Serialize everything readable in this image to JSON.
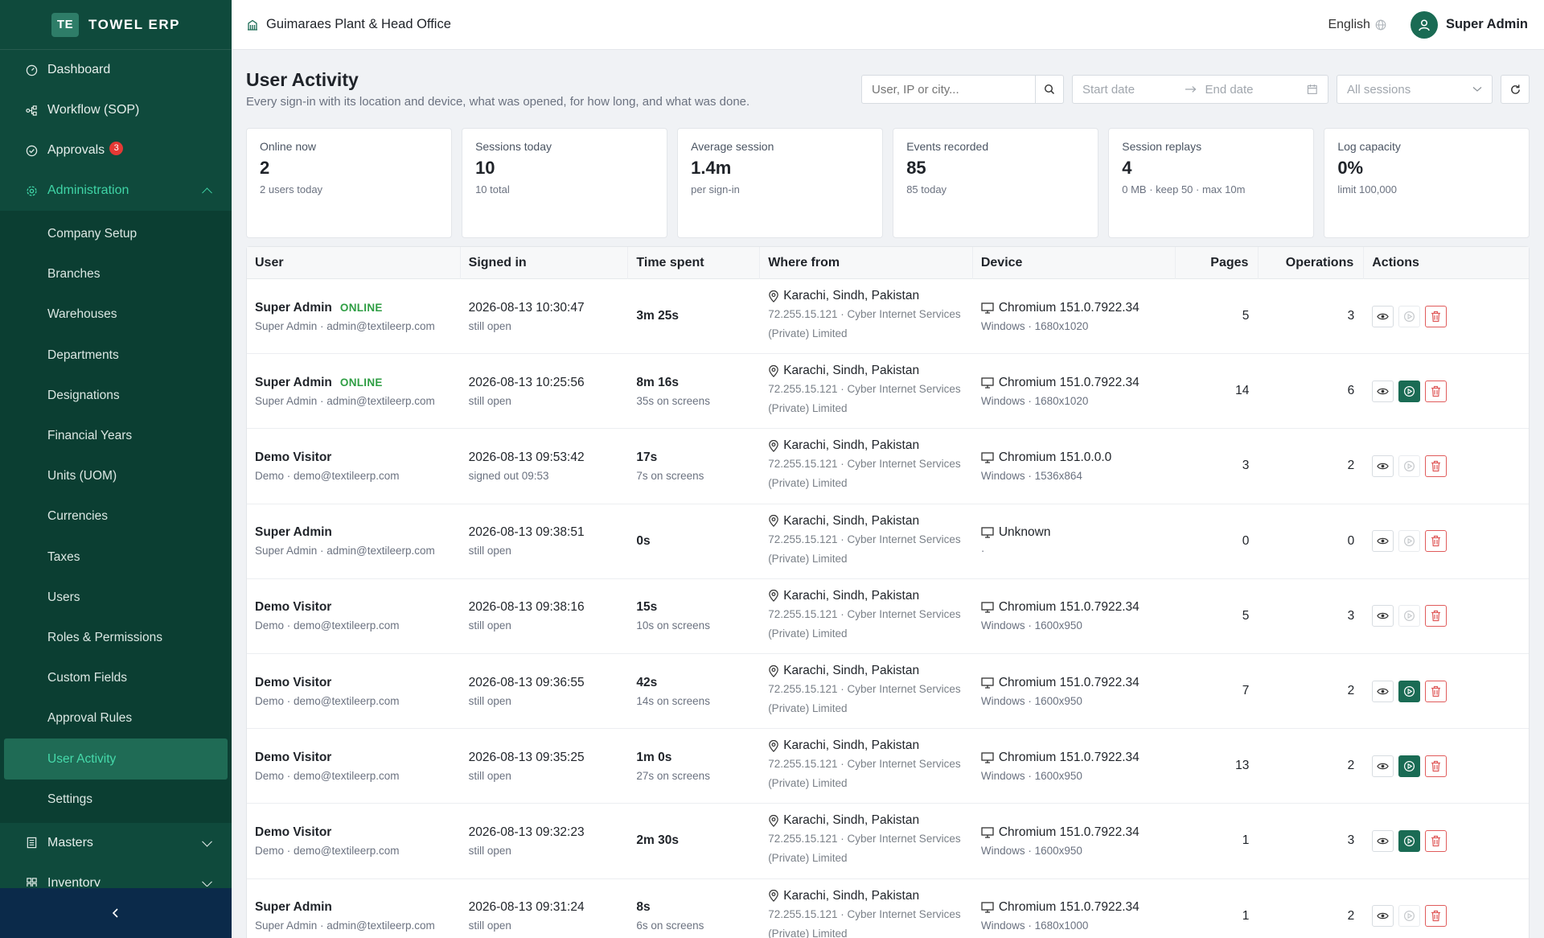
{
  "brand": {
    "logo": "TE",
    "name": "TOWEL ERP"
  },
  "sidebar": {
    "top_items": [
      {
        "label": "Dashboard",
        "icon": "gauge-icon"
      },
      {
        "label": "Workflow (SOP)",
        "icon": "workflow-icon"
      },
      {
        "label": "Approvals",
        "icon": "check-circle-icon",
        "badge": "3"
      },
      {
        "label": "Administration",
        "icon": "gear-icon"
      }
    ],
    "admin_items": [
      "Company Setup",
      "Branches",
      "Warehouses",
      "Departments",
      "Designations",
      "Financial Years",
      "Units (UOM)",
      "Currencies",
      "Taxes",
      "Users",
      "Roles & Permissions",
      "Custom Fields",
      "Approval Rules",
      "User Activity",
      "Settings"
    ],
    "bottom_items": [
      {
        "label": "Masters",
        "icon": "list-icon"
      },
      {
        "label": "Inventory",
        "icon": "grid-icon"
      }
    ],
    "collapse_glyph": "<"
  },
  "header": {
    "org": "Guimaraes Plant & Head Office",
    "language": "English",
    "user": "Super Admin"
  },
  "page": {
    "title": "User Activity",
    "subtitle": "Every sign-in with its location and device, what was opened, for how long, and what was done."
  },
  "filters": {
    "search_placeholder": "User, IP or city...",
    "start_placeholder": "Start date",
    "end_placeholder": "End date",
    "sessions_placeholder": "All sessions"
  },
  "stats": [
    {
      "label": "Online now",
      "value": "2",
      "hint": "2 users today"
    },
    {
      "label": "Sessions today",
      "value": "10",
      "hint": "10 total"
    },
    {
      "label": "Average session",
      "value": "1.4m",
      "hint": "per sign-in"
    },
    {
      "label": "Events recorded",
      "value": "85",
      "hint": "85 today"
    },
    {
      "label": "Session replays",
      "value": "4",
      "hint": "0 MB · keep 50 · max 10m"
    },
    {
      "label": "Log capacity",
      "value": "0%",
      "hint": "limit 100,000"
    }
  ],
  "table": {
    "headers": [
      "User",
      "Signed in",
      "Time spent",
      "Where from",
      "Device",
      "Pages",
      "Operations",
      "Actions"
    ],
    "online_label": "ONLINE",
    "rows": [
      {
        "name": "Super Admin",
        "online": true,
        "sub": "Super Admin · admin@textileerp.com",
        "signed": "2026-08-13 10:30:47",
        "signed_sub": "still open",
        "time": "3m 25s",
        "time_sub": "",
        "loc": "Karachi, Sindh, Pakistan",
        "isp1": "72.255.15.121 · Cyber Internet Services",
        "isp2": "(Private) Limited",
        "device": "Chromium 151.0.7922.34",
        "device_sub": "Windows · 1680x1020",
        "pages": "5",
        "ops": "3",
        "replay": false
      },
      {
        "name": "Super Admin",
        "online": true,
        "sub": "Super Admin · admin@textileerp.com",
        "signed": "2026-08-13 10:25:56",
        "signed_sub": "still open",
        "time": "8m 16s",
        "time_sub": "35s on screens",
        "loc": "Karachi, Sindh, Pakistan",
        "isp1": "72.255.15.121 · Cyber Internet Services",
        "isp2": "(Private) Limited",
        "device": "Chromium 151.0.7922.34",
        "device_sub": "Windows · 1680x1020",
        "pages": "14",
        "ops": "6",
        "replay": true
      },
      {
        "name": "Demo Visitor",
        "online": false,
        "sub": "Demo · demo@textileerp.com",
        "signed": "2026-08-13 09:53:42",
        "signed_sub": "signed out 09:53",
        "time": "17s",
        "time_sub": "7s on screens",
        "loc": "Karachi, Sindh, Pakistan",
        "isp1": "72.255.15.121 · Cyber Internet Services",
        "isp2": "(Private) Limited",
        "device": "Chromium 151.0.0.0",
        "device_sub": "Windows · 1536x864",
        "pages": "3",
        "ops": "2",
        "replay": false
      },
      {
        "name": "Super Admin",
        "online": false,
        "sub": "Super Admin · admin@textileerp.com",
        "signed": "2026-08-13 09:38:51",
        "signed_sub": "still open",
        "time": "0s",
        "time_sub": "",
        "loc": "Karachi, Sindh, Pakistan",
        "isp1": "72.255.15.121 · Cyber Internet Services",
        "isp2": "(Private) Limited",
        "device": "Unknown",
        "device_sub": "·",
        "pages": "0",
        "ops": "0",
        "replay": false
      },
      {
        "name": "Demo Visitor",
        "online": false,
        "sub": "Demo · demo@textileerp.com",
        "signed": "2026-08-13 09:38:16",
        "signed_sub": "still open",
        "time": "15s",
        "time_sub": "10s on screens",
        "loc": "Karachi, Sindh, Pakistan",
        "isp1": "72.255.15.121 · Cyber Internet Services",
        "isp2": "(Private) Limited",
        "device": "Chromium 151.0.7922.34",
        "device_sub": "Windows · 1600x950",
        "pages": "5",
        "ops": "3",
        "replay": false
      },
      {
        "name": "Demo Visitor",
        "online": false,
        "sub": "Demo · demo@textileerp.com",
        "signed": "2026-08-13 09:36:55",
        "signed_sub": "still open",
        "time": "42s",
        "time_sub": "14s on screens",
        "loc": "Karachi, Sindh, Pakistan",
        "isp1": "72.255.15.121 · Cyber Internet Services",
        "isp2": "(Private) Limited",
        "device": "Chromium 151.0.7922.34",
        "device_sub": "Windows · 1600x950",
        "pages": "7",
        "ops": "2",
        "replay": true
      },
      {
        "name": "Demo Visitor",
        "online": false,
        "sub": "Demo · demo@textileerp.com",
        "signed": "2026-08-13 09:35:25",
        "signed_sub": "still open",
        "time": "1m 0s",
        "time_sub": "27s on screens",
        "loc": "Karachi, Sindh, Pakistan",
        "isp1": "72.255.15.121 · Cyber Internet Services",
        "isp2": "(Private) Limited",
        "device": "Chromium 151.0.7922.34",
        "device_sub": "Windows · 1600x950",
        "pages": "13",
        "ops": "2",
        "replay": true
      },
      {
        "name": "Demo Visitor",
        "online": false,
        "sub": "Demo · demo@textileerp.com",
        "signed": "2026-08-13 09:32:23",
        "signed_sub": "still open",
        "time": "2m 30s",
        "time_sub": "",
        "loc": "Karachi, Sindh, Pakistan",
        "isp1": "72.255.15.121 · Cyber Internet Services",
        "isp2": "(Private) Limited",
        "device": "Chromium 151.0.7922.34",
        "device_sub": "Windows · 1600x950",
        "pages": "1",
        "ops": "3",
        "replay": true
      },
      {
        "name": "Super Admin",
        "online": false,
        "sub": "Super Admin · admin@textileerp.com",
        "signed": "2026-08-13 09:31:24",
        "signed_sub": "still open",
        "time": "8s",
        "time_sub": "6s on screens",
        "loc": "Karachi, Sindh, Pakistan",
        "isp1": "72.255.15.121 · Cyber Internet Services",
        "isp2": "(Private) Limited",
        "device": "Chromium 151.0.7922.34",
        "device_sub": "Windows · 1680x1000",
        "pages": "1",
        "ops": "2",
        "replay": false
      }
    ]
  },
  "colors": {
    "sidebar": "#0f4a3c",
    "accent": "#3fd4a6",
    "primary": "#1a6b54",
    "online": "#2f9e44",
    "danger": "#e05b5b"
  }
}
